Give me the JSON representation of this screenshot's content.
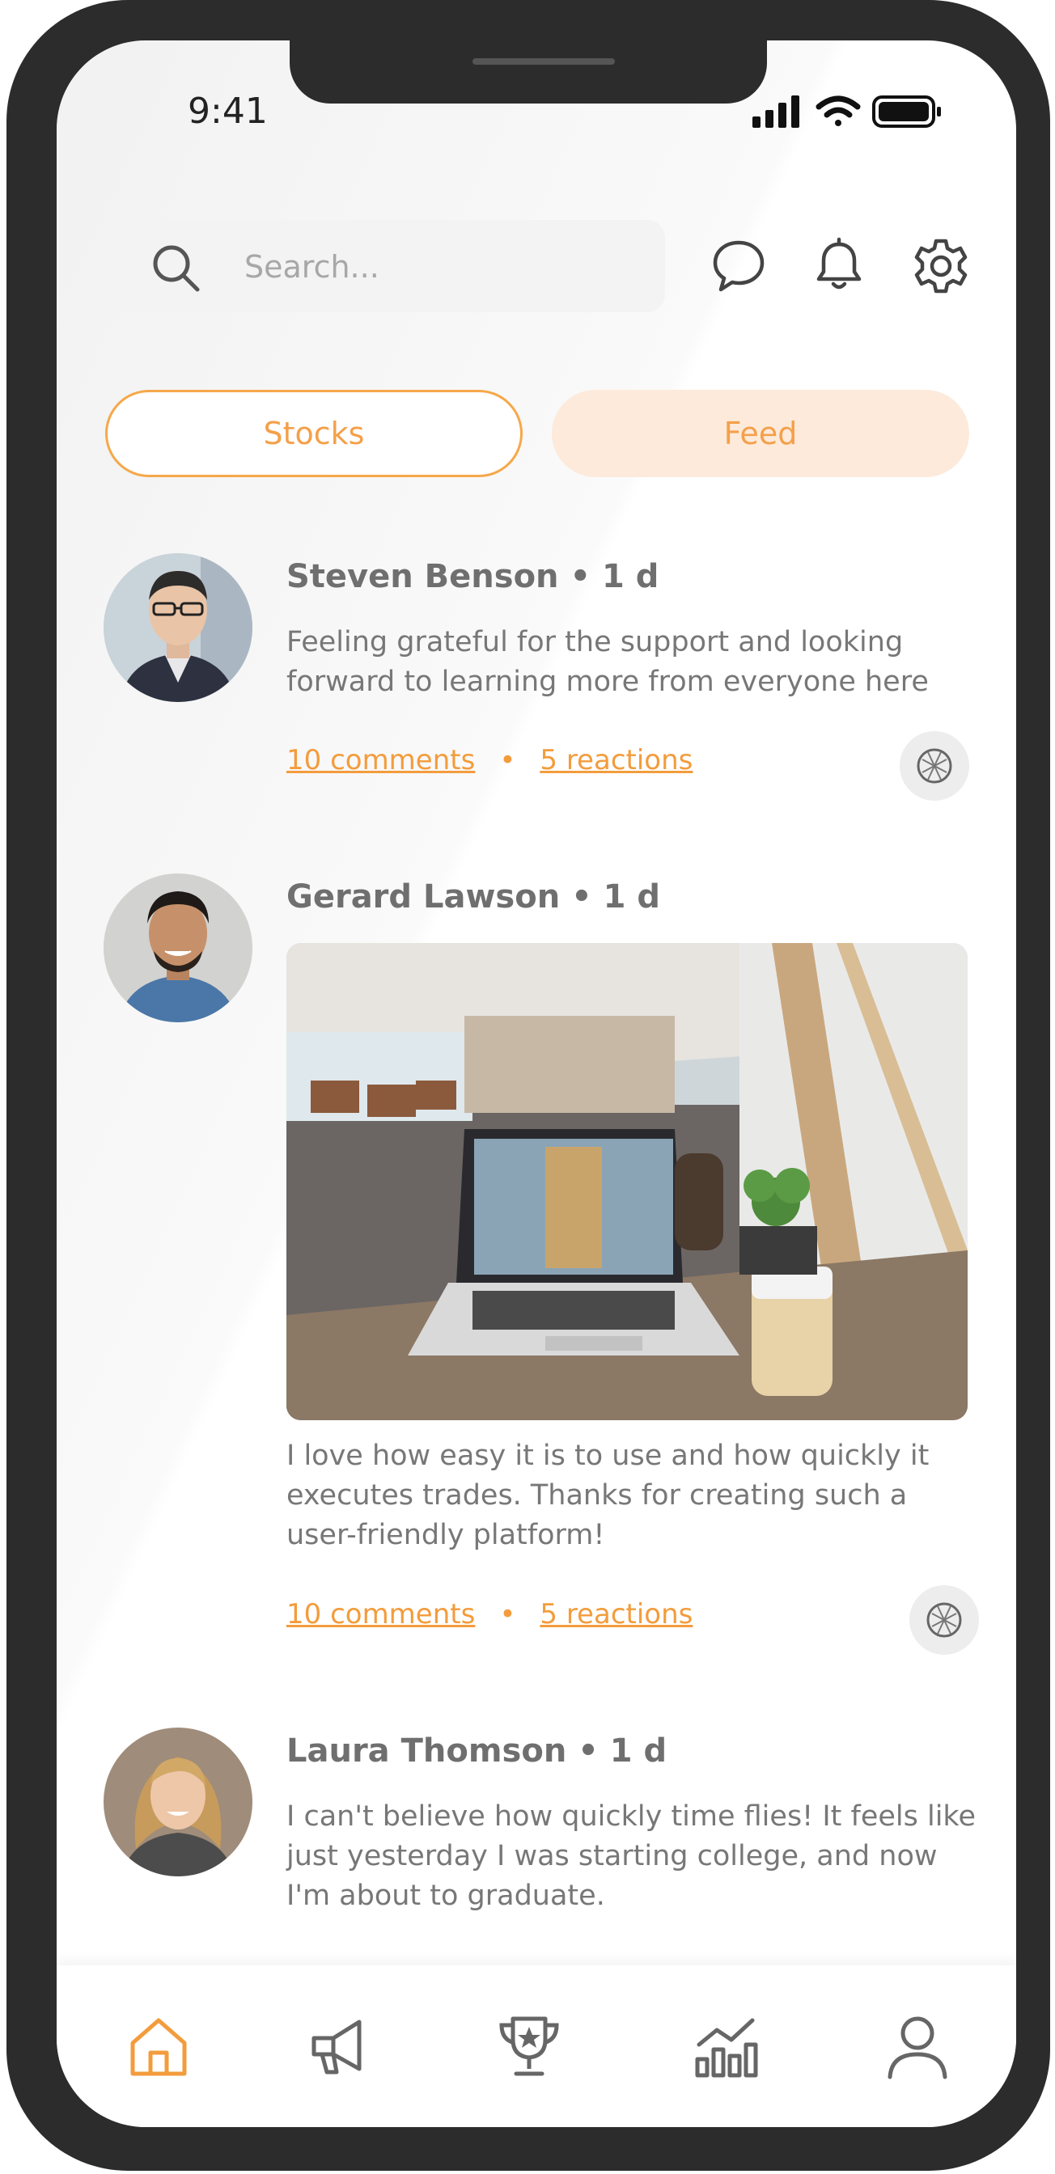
{
  "status_bar": {
    "time": "9:41"
  },
  "search": {
    "placeholder": "Search..."
  },
  "tabs": [
    {
      "label": "Stocks",
      "state": "outlined"
    },
    {
      "label": "Feed",
      "state": "filled"
    }
  ],
  "colors": {
    "accent": "#f39c3c",
    "tab_fill": "#fdeadb",
    "frame": "#2c2c2c"
  },
  "posts": [
    {
      "author": "Steven Benson • 1 d",
      "text": "Feeling grateful for the support and looking forward to learning more from everyone here",
      "comments": "10 comments",
      "reactions": "5 reactions"
    },
    {
      "author": "Gerard Lawson • 1 d",
      "text": "I love how easy it is to use and how quickly it executes trades. Thanks for creating such a user-friendly platform!",
      "comments": "10 comments",
      "reactions": "5 reactions"
    },
    {
      "author": "Laura Thomson • 1 d",
      "text": "I can't believe how quickly time flies! It feels like just yesterday I was starting college, and now I'm about to graduate."
    }
  ],
  "bottom_nav": [
    {
      "icon": "home-icon",
      "active": true
    },
    {
      "icon": "megaphone-icon",
      "active": false
    },
    {
      "icon": "trophy-icon",
      "active": false
    },
    {
      "icon": "chart-icon",
      "active": false
    },
    {
      "icon": "profile-icon",
      "active": false
    }
  ]
}
